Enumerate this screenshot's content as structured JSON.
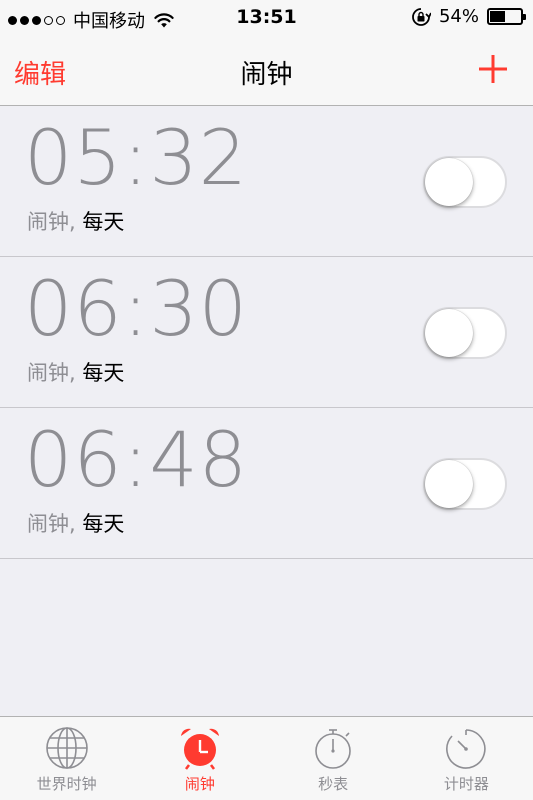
{
  "status_bar": {
    "carrier": "中国移动",
    "time": "13:51",
    "battery_percent": "54%",
    "battery_level": 0.54,
    "signal_bars": 3,
    "signal_total": 5
  },
  "nav": {
    "edit_label": "编辑",
    "title": "闹钟",
    "add_icon": "plus-icon"
  },
  "alarms": [
    {
      "time": "05:32",
      "label": "闹钟,",
      "repeat": "每天",
      "enabled": false
    },
    {
      "time": "06:30",
      "label": "闹钟,",
      "repeat": "每天",
      "enabled": false
    },
    {
      "time": "06:48",
      "label": "闹钟,",
      "repeat": "每天",
      "enabled": false
    }
  ],
  "tabs": [
    {
      "label": "世界时钟",
      "icon": "globe-icon",
      "active": false
    },
    {
      "label": "闹钟",
      "icon": "alarm-clock-icon",
      "active": true
    },
    {
      "label": "秒表",
      "icon": "stopwatch-icon",
      "active": false
    },
    {
      "label": "计时器",
      "icon": "timer-icon",
      "active": false
    }
  ],
  "colors": {
    "accent": "#ff3b30",
    "inactive_tab": "#8e8e93",
    "background": "#efeff4"
  }
}
